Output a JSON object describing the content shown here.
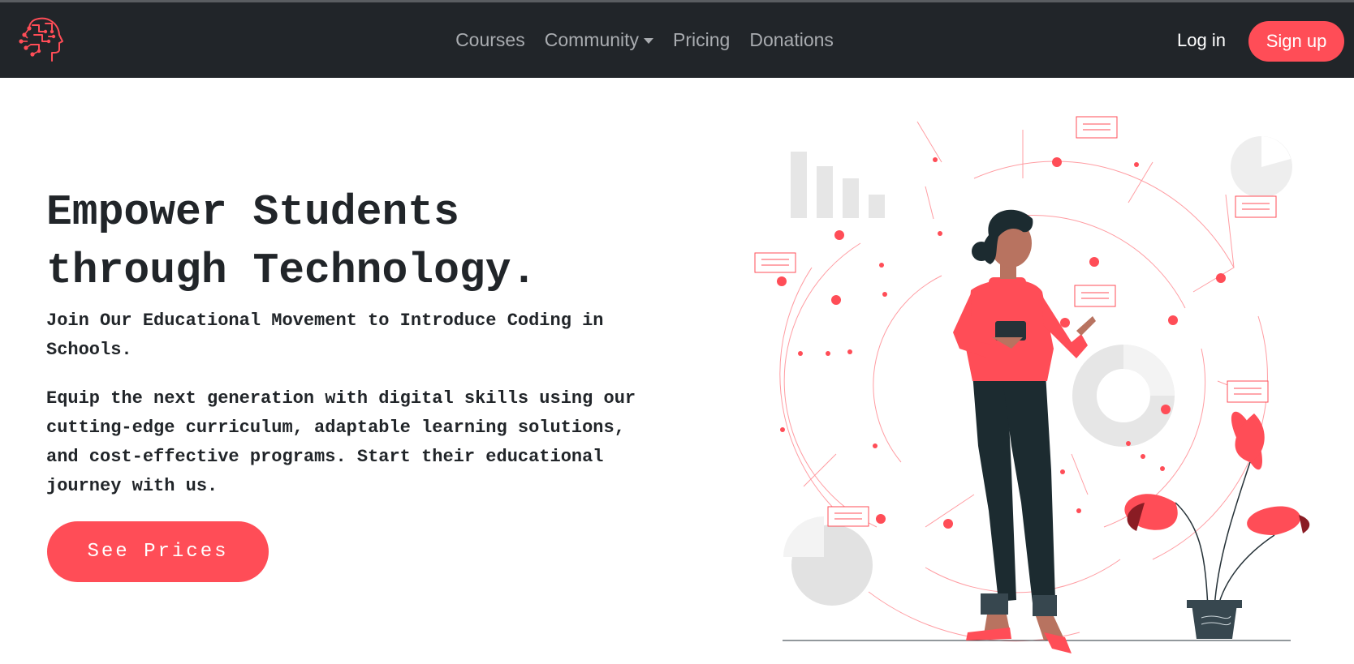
{
  "navbar": {
    "logo_icon": "brain-circuit-head-logo",
    "links": [
      {
        "label": "Courses"
      },
      {
        "label": "Community",
        "has_dropdown": true
      },
      {
        "label": "Pricing"
      },
      {
        "label": "Donations"
      }
    ],
    "login_label": "Log in",
    "signup_label": "Sign up"
  },
  "hero": {
    "title_line1": "Empower Students",
    "title_line2": "through Technology.",
    "subtitle": "Join Our Educational Movement to Introduce Coding in Schools.",
    "description": "Equip the next generation with digital skills using our cutting-edge curriculum, adaptable learning solutions, and cost-effective programs. Start their educational journey with us.",
    "cta_label": "See Prices",
    "illustration": "woman-with-tablet-network-illustration"
  },
  "colors": {
    "navbar_bg": "#212529",
    "accent": "#ff4d57",
    "nav_link": "#a9acb0",
    "text": "#212529"
  }
}
